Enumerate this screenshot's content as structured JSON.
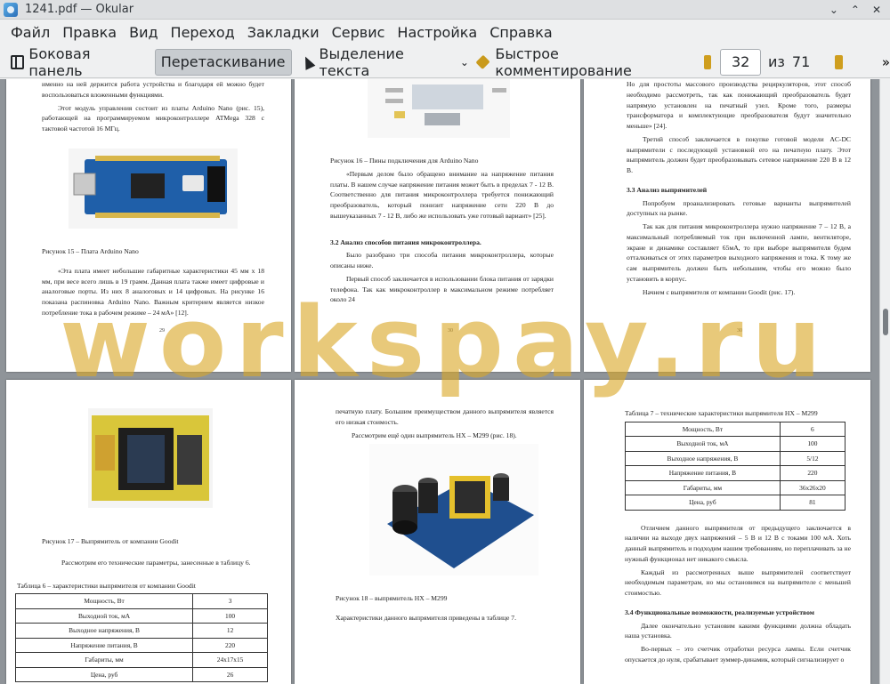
{
  "window": {
    "title": "1241.pdf — Okular",
    "controls": [
      "⌄",
      "⌃",
      "✕"
    ]
  },
  "menu": [
    "Файл",
    "Правка",
    "Вид",
    "Переход",
    "Закладки",
    "Сервис",
    "Настройка",
    "Справка"
  ],
  "toolbar": {
    "sidebar_label": "Боковая панель",
    "drag_label": "Перетаскивание",
    "select_text_label": "Выделение текста",
    "quick_comment_label": "Быстрое комментирование",
    "page_current": "32",
    "of_label": "из",
    "page_total": "71",
    "more_label": "»"
  },
  "watermark": "worksрay.ru",
  "pages": {
    "p1": {
      "lines": [
        "именно на ней держится работа устройства и благодаря ей можно будет воспользоваться вложенными функциями.",
        "Этот модуль управления состоит из платы Arduino Nano (рис. 15), работающей на программируемом микроконтроллере ATMega 328 с тактовой частотой 16 МГц."
      ],
      "caption": "Рисунок 15 – Плата Arduino Nano",
      "body": "«Эта плата имеет небольшие габаритные характеристики 45 мм х 18 мм, при весе всего лишь в 19 грамм. Данная плата также имеет цифровые и аналоговые порты. Из них 8 аналоговых и 14 цифровых. На рисунке 16 показана распиновка Arduino Nano. Важным критерием является низкое потребление тока в рабочем режиме – 24 мА» [12].",
      "num": "29"
    },
    "p2": {
      "caption": "Рисунок 16 – Пины подключения для Arduino Nano",
      "body": "«Первым делом было обращено внимание на напряжение питания платы. В нашем случае напряжение питания может быть в пределах 7 - 12 В. Соответственно для питания микроконтроллера требуется понижающий преобразователь, который понизит напряжение сети 220 В до вышеуказанных 7 - 12 В, либо же использовать уже готовый вариант» [25].",
      "heading": "3.2 Анализ способов питания микроконтроллера.",
      "body2": "Было разобрано три способа питания микроконтроллера, которые описаны ниже.",
      "body3": "Первый способ заключается в использовании блока питания от зарядки телефона. Так как микроконтроллер в максимальном режиме потребляет около 24",
      "num": "30"
    },
    "p3": {
      "body": "Но для простоты массового производства рециркуляторов, этот способ необходимо рассмотреть, так как понижающий преобразователь будет напрямую установлен на печатный узел. Кроме того, размеры трансформатора и комплектующие преобразователя будут значительно меньше» [24].",
      "body2": "Третий способ заключается в покупке готовой модели AC-DC выпрямители с последующей установкой его на печатную плату. Этот выпрямитель должен будет преобразовывать сетевое напряжение 220 В в 12 В.",
      "heading": "3.3 Анализ выпрямителей",
      "body3": "Попробуем проанализировать готовые варианты выпрямителей доступных на рынке.",
      "body4": "Так как для питания микроконтроллера нужно напряжение 7 – 12 В, а максимальный потребляемый ток при включенной лампе, вентиляторе, экране и динамике составляет 65мА, то при выборе выпрямителя будем отталкиваться от этих параметров выходного напряжения и тока. К тому же сам выпрямитель должен быть небольшим, чтобы его можно было установить в корпус.",
      "body5": "Начнем с выпрямителя от компании Goodit (рис. 17).",
      "num": "30"
    },
    "p4": {
      "caption": "Рисунок 17 – Выпрямитель от компании Goodit",
      "body": "Рассмотрим его технические параметры, занесенные в таблицу 6.",
      "table_title": "Таблица 6 – характеристики выпрямителя от компании Goodit",
      "rows": [
        [
          "Мощность, Вт",
          "3"
        ],
        [
          "Выходной ток, мА",
          "100"
        ],
        [
          "Выходное напряжения, В",
          "12"
        ],
        [
          "Напряжение питания, В",
          "220"
        ],
        [
          "Габариты, мм",
          "24х17х15"
        ],
        [
          "Цена, руб",
          "26"
        ]
      ]
    },
    "p5": {
      "body": "печатную плату. Большим преимуществом данного выпрямителя является его низкая стоимость.",
      "body2": "Рассмотрим ещё один выпрямитель HX – M299 (рис. 18).",
      "caption": "Рисунок 18 – выпрямитель HX – M299",
      "body3": "Характеристики данного выпрямителя приведены в таблице 7."
    },
    "p6": {
      "table_title": "Таблица 7 – технические характеристики выпрямителя HX – M299",
      "rows": [
        [
          "Мощность, Вт",
          "6"
        ],
        [
          "Выходной ток, мА",
          "100"
        ],
        [
          "Выходное напряжения, В",
          "5/12"
        ],
        [
          "Напряжение питания, В",
          "220"
        ],
        [
          "Габариты, мм",
          "36х26х20"
        ],
        [
          "Цена, руб",
          "81"
        ]
      ],
      "body": "Отличием данного выпрямителя от предыдущего заключается в наличии на выходе двух напряжений – 5 В и 12 В с токами 100 мА. Хоть данный выпрямитель и подходим нашим требованиям, но переплачивать за не нужный функционал нет никакого смысла.",
      "body2": "Каждый из рассмотренных выше выпрямителей соответствует необходимым параметрам, но мы остановимся на выпрямителе с меньшей стоимостью.",
      "heading": "3.4 Функциональные возможности, реализуемые устройством",
      "body3": "Далее окончательно установим какими функциями должна обладать наша установка.",
      "body4": "Во-первых – это счетчик отработки ресурса лампы. Если счетчик опускается до нуля, срабатывает зуммер-динамик, который сигнализирует о"
    }
  }
}
